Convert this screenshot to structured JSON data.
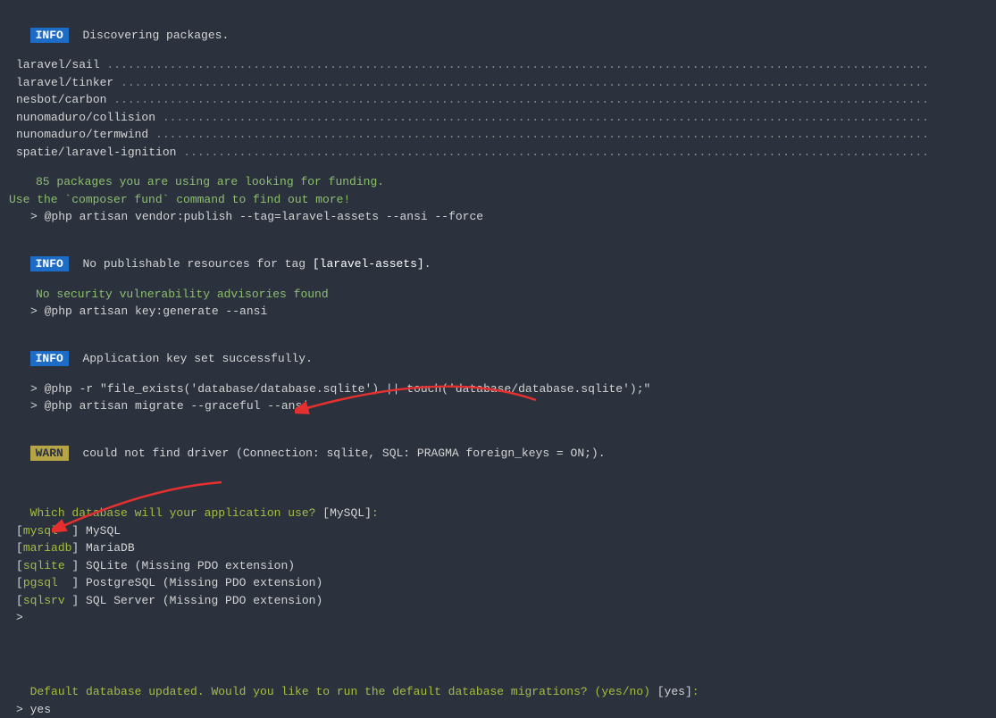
{
  "badges": {
    "info": "INFO",
    "warn": "WARN"
  },
  "lines": {
    "discover": "Discovering packages.",
    "pkg1": "laravel/sail",
    "pkg2": "laravel/tinker",
    "pkg3": "nesbot/carbon",
    "pkg4": "nunomaduro/collision",
    "pkg5": "nunomaduro/termwind",
    "pkg6": "spatie/laravel-ignition",
    "funding1": "85 packages you are using are looking for funding.",
    "funding2": "Use the `composer fund` command to find out more!",
    "cmd1": "> @php artisan vendor:publish --tag=laravel-assets --ansi --force",
    "nopub_pre": "No publishable resources for tag ",
    "nopub_tag": "[laravel-assets]",
    "nopub_post": ".",
    "security": "No security vulnerability advisories found",
    "cmd2": "> @php artisan key:generate --ansi",
    "keyset": "Application key set successfully.",
    "cmd3": "> @php -r \"file_exists('database/database.sqlite') || touch('database/database.sqlite');\"",
    "cmd4": "> @php artisan migrate --graceful --ansi",
    "warn_msg": "could not find driver (Connection: sqlite, SQL: PRAGMA foreign_keys = ON;).",
    "db_q": "Which database will your application use?",
    "db_default": "[MySQL]",
    "db_colon": ":",
    "opt1_key": "mysql  ",
    "opt1_label": " MySQL",
    "opt2_key": "mariadb",
    "opt2_label": " MariaDB",
    "opt3_key": "sqlite ",
    "opt3_label": " SQLite (Missing PDO extension)",
    "opt4_key": "pgsql  ",
    "opt4_label": " PostgreSQL (Missing PDO extension)",
    "opt5_key": "sqlsrv ",
    "opt5_label": " SQL Server (Missing PDO extension)",
    "prompt1": ">",
    "final_q": "Default database updated. Would you like to run the default database migrations? (yes/no) ",
    "final_default": "[yes]",
    "final_colon": ":",
    "prompt2": "> yes"
  }
}
